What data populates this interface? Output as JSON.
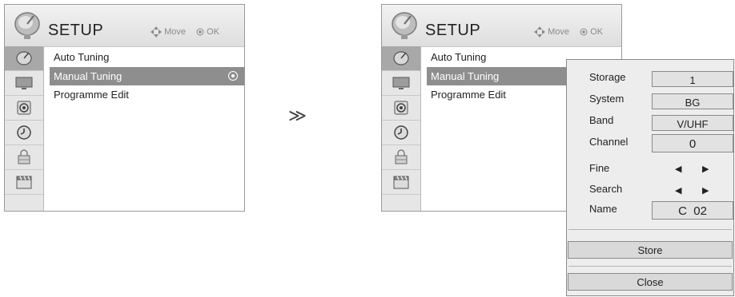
{
  "left_panel": {
    "title": "SETUP",
    "hint_move": "Move",
    "hint_ok": "OK",
    "menu": [
      {
        "label": "Auto Tuning",
        "selected": false
      },
      {
        "label": "Manual Tuning",
        "selected": true
      },
      {
        "label": "Programme Edit",
        "selected": false
      }
    ]
  },
  "right_panel": {
    "title": "SETUP",
    "hint_move": "Move",
    "hint_ok": "OK",
    "menu": [
      {
        "label": "Auto Tuning",
        "selected": false
      },
      {
        "label": "Manual Tuning",
        "selected": true
      },
      {
        "label": "Programme Edit",
        "selected": false
      }
    ]
  },
  "sidebar_icons": [
    "satellite-icon",
    "picture-icon",
    "audio-icon",
    "clock-icon",
    "lock-icon",
    "clapperboard-icon"
  ],
  "transition_arrow": "≫",
  "manual_tuning": {
    "fields": [
      {
        "label": "Storage",
        "value": "1"
      },
      {
        "label": "System",
        "value": "BG"
      },
      {
        "label": "Band",
        "value": "V/UHF"
      },
      {
        "label": "Channel",
        "value": "0"
      }
    ],
    "fine_label": "Fine",
    "search_label": "Search",
    "name_label": "Name",
    "name_value": "C  02",
    "store_label": "Store",
    "close_label": "Close"
  },
  "colors": {
    "highlight": "#8e8e8e",
    "sidebar": "#e6e6e6",
    "popup_bg": "#ededed"
  }
}
